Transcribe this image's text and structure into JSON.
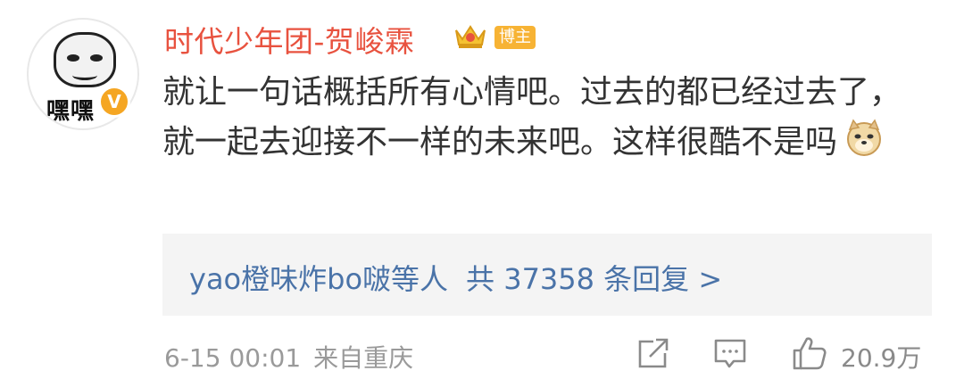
{
  "post": {
    "username": "时代少年团-贺峻霖",
    "badge": "博主",
    "avatar_text": "嘿嘿",
    "verified_mark": "V",
    "content": "就让一句话概括所有心情吧。过去的都已经过去了，就一起去迎接不一样的未来吧。这样很酷不是吗",
    "replies": {
      "users": "yao橙味炸bo啵等人",
      "count_text": "共 37358 条回复 >"
    },
    "footer": {
      "timestamp": "6-15 00:01",
      "source": "来自重庆",
      "likes": "20.9万"
    },
    "icons": {
      "crown": "crown-icon",
      "emoji": "doge-emoji-icon",
      "share": "share-icon",
      "comment": "comment-icon",
      "like": "thumbs-up-icon"
    },
    "colors": {
      "username": "#e8523f",
      "link": "#4a73a8",
      "badge": "#f7b334",
      "meta": "#9a9a9a"
    }
  }
}
